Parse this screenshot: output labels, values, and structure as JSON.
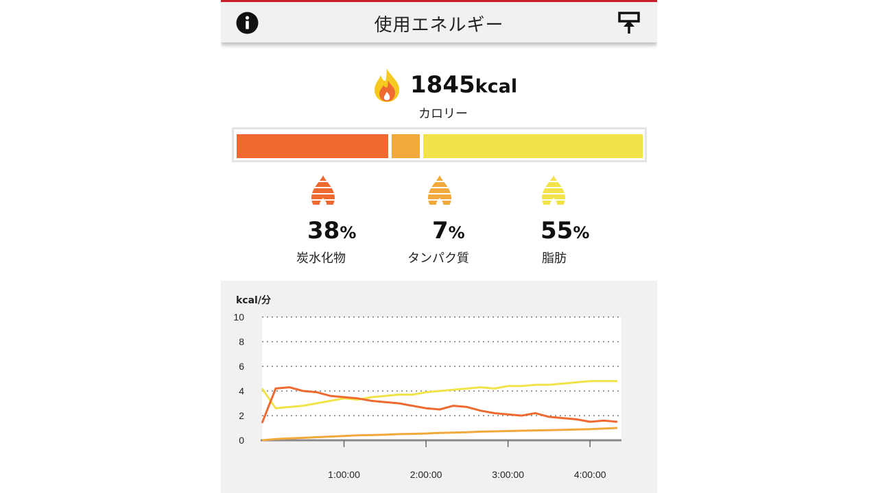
{
  "header": {
    "title": "使用エネルギー",
    "info_icon": "info-icon",
    "share_icon": "upload-share-icon"
  },
  "summary": {
    "value": "1845",
    "unit": "kcal",
    "label": "カロリー",
    "icon": "flame-icon"
  },
  "colors": {
    "carb": "#ee6a30",
    "protein": "#f2a93b",
    "fat": "#f2e34a"
  },
  "macros": [
    {
      "name": "炭水化物",
      "percent": "38",
      "symbol": "%",
      "fraction": 0.38,
      "icon": "carb-flame-icon"
    },
    {
      "name": "タンパク質",
      "percent": "7",
      "symbol": "%",
      "fraction": 0.07,
      "icon": "protein-flame-icon"
    },
    {
      "name": "脂肪",
      "percent": "55",
      "symbol": "%",
      "fraction": 0.55,
      "icon": "fat-flame-icon"
    }
  ],
  "chart_data": {
    "type": "line",
    "title": "",
    "ylabel": "kcal/分",
    "xlabel": "",
    "ylim": [
      0,
      10
    ],
    "yticks": [
      0,
      2,
      4,
      6,
      8,
      10
    ],
    "xlim": [
      "0:00:00",
      "4:23:00"
    ],
    "xticks": [
      "1:00:00",
      "2:00:00",
      "3:00:00",
      "4:00:00"
    ],
    "grid": true,
    "x": [
      "0:00:00",
      "0:10:00",
      "0:20:00",
      "0:30:00",
      "0:40:00",
      "0:50:00",
      "1:00:00",
      "1:10:00",
      "1:20:00",
      "1:30:00",
      "1:40:00",
      "1:50:00",
      "2:00:00",
      "2:10:00",
      "2:20:00",
      "2:30:00",
      "2:40:00",
      "2:50:00",
      "3:00:00",
      "3:10:00",
      "3:20:00",
      "3:30:00",
      "3:40:00",
      "3:50:00",
      "4:00:00",
      "4:10:00",
      "4:20:00"
    ],
    "series": [
      {
        "values": [
          1.4,
          4.2,
          4.3,
          4.0,
          3.9,
          3.6,
          3.5,
          3.4,
          3.2,
          3.1,
          3.0,
          2.8,
          2.6,
          2.5,
          2.8,
          2.7,
          2.4,
          2.2,
          2.1,
          2.0,
          2.2,
          1.9,
          1.8,
          1.7,
          1.5,
          1.6,
          1.5
        ]
      },
      {
        "values": [
          0.0,
          0.1,
          0.15,
          0.2,
          0.25,
          0.3,
          0.35,
          0.4,
          0.42,
          0.45,
          0.5,
          0.52,
          0.55,
          0.6,
          0.62,
          0.65,
          0.7,
          0.72,
          0.75,
          0.78,
          0.8,
          0.82,
          0.85,
          0.88,
          0.9,
          0.95,
          1.0
        ]
      },
      {
        "values": [
          4.2,
          2.6,
          2.7,
          2.8,
          3.0,
          3.2,
          3.4,
          3.3,
          3.5,
          3.6,
          3.7,
          3.7,
          3.9,
          4.0,
          4.1,
          4.2,
          4.3,
          4.2,
          4.4,
          4.4,
          4.5,
          4.5,
          4.6,
          4.7,
          4.8,
          4.8,
          4.8
        ]
      }
    ]
  }
}
